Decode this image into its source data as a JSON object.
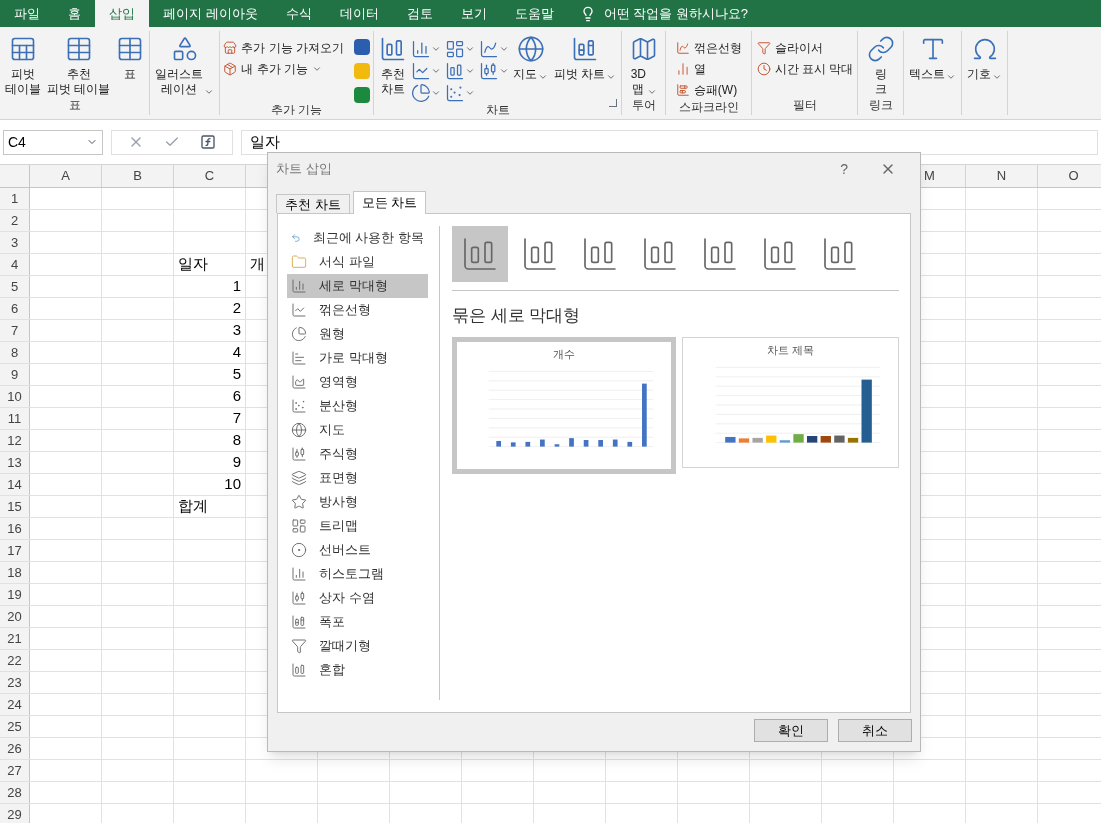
{
  "tabs": [
    {
      "label": "파일",
      "selected": false
    },
    {
      "label": "홈",
      "selected": false
    },
    {
      "label": "삽입",
      "selected": true
    },
    {
      "label": "페이지 레이아웃",
      "selected": false
    },
    {
      "label": "수식",
      "selected": false
    },
    {
      "label": "데이터",
      "selected": false
    },
    {
      "label": "검토",
      "selected": false
    },
    {
      "label": "보기",
      "selected": false
    },
    {
      "label": "도움말",
      "selected": false
    }
  ],
  "tell_me": "어떤 작업을 원하시나요?",
  "ribbon_groups": [
    {
      "label": "표",
      "items": [
        {
          "kind": "large",
          "text": "피벗\n테이블",
          "dropdown": false
        },
        {
          "kind": "large",
          "text": "추천\n피벗 테이블",
          "dropdown": false
        },
        {
          "kind": "large",
          "text": "표",
          "dropdown": false
        }
      ]
    },
    {
      "items": [
        {
          "kind": "large",
          "text": "일러스트\n레이션",
          "dropdown": true
        }
      ]
    },
    {
      "label": "추가 기능",
      "items": [
        {
          "kind": "smallstack",
          "entries": [
            {
              "text": "추가 기능 가져오기",
              "dropdown": false
            },
            {
              "text": "내 추가 기능",
              "dropdown": true
            }
          ]
        },
        {
          "kind": "apps"
        }
      ]
    },
    {
      "label": "차트",
      "launcher": true,
      "items": [
        {
          "kind": "large",
          "text": "추천\n차트",
          "dropdown": false
        },
        {
          "kind": "gallery"
        },
        {
          "kind": "large",
          "text": "지도",
          "dropdown": true
        },
        {
          "kind": "large",
          "text": "피벗 차트",
          "dropdown": true
        }
      ]
    },
    {
      "label": "투어",
      "items": [
        {
          "kind": "large",
          "text": "3D\n맵",
          "dropdown": true
        }
      ]
    },
    {
      "label": "스파크라인",
      "items": [
        {
          "kind": "smallstack",
          "entries": [
            {
              "text": "꺾은선형",
              "dropdown": false
            },
            {
              "text": "열",
              "dropdown": false
            },
            {
              "text": "승패(W)",
              "dropdown": false
            }
          ]
        }
      ]
    },
    {
      "label": "필터",
      "items": [
        {
          "kind": "smallstack",
          "entries": [
            {
              "text": "슬라이서",
              "dropdown": false
            },
            {
              "text": "시간 표시 막대",
              "dropdown": false
            }
          ]
        }
      ]
    },
    {
      "label": "링크",
      "items": [
        {
          "kind": "large",
          "text": "링\n크",
          "dropdown": false
        }
      ]
    },
    {
      "items": [
        {
          "kind": "large",
          "text": "텍스트",
          "dropdown": true
        }
      ]
    },
    {
      "items": [
        {
          "kind": "large",
          "text": "기호",
          "dropdown": true
        }
      ]
    }
  ],
  "formula_bar": {
    "name_box": "C4",
    "value": "일자"
  },
  "sheet": {
    "columns_left": [
      "A",
      "B",
      "C"
    ],
    "columns_right": [
      "M",
      "N",
      "O"
    ],
    "rows": [
      {
        "header": "1"
      },
      {
        "header": "2"
      },
      {
        "header": "3"
      },
      {
        "header": "4",
        "cells": [
          {
            "text": "일자",
            "kind": "text"
          },
          {
            "text": "개"
          }
        ]
      },
      {
        "header": "5",
        "cells": [
          {
            "text": "1",
            "kind": "number"
          }
        ]
      },
      {
        "header": "6",
        "cells": [
          {
            "text": "2",
            "kind": "number"
          }
        ]
      },
      {
        "header": "7",
        "cells": [
          {
            "text": "3",
            "kind": "number"
          }
        ]
      },
      {
        "header": "8",
        "cells": [
          {
            "text": "4",
            "kind": "number"
          }
        ]
      },
      {
        "header": "9",
        "cells": [
          {
            "text": "5",
            "kind": "number"
          }
        ]
      },
      {
        "header": "10",
        "cells": [
          {
            "text": "6",
            "kind": "number"
          }
        ]
      },
      {
        "header": "11",
        "cells": [
          {
            "text": "7",
            "kind": "number"
          }
        ]
      },
      {
        "header": "12",
        "cells": [
          {
            "text": "8",
            "kind": "number"
          }
        ]
      },
      {
        "header": "13",
        "cells": [
          {
            "text": "9",
            "kind": "number"
          }
        ]
      },
      {
        "header": "14",
        "cells": [
          {
            "text": "10",
            "kind": "number"
          }
        ]
      },
      {
        "header": "15",
        "cells": [
          {
            "text": "합계",
            "kind": "text"
          }
        ]
      },
      {
        "header": "16"
      },
      {
        "header": "17"
      },
      {
        "header": "18"
      },
      {
        "header": "19"
      },
      {
        "header": "20"
      },
      {
        "header": "21"
      },
      {
        "header": "22"
      },
      {
        "header": "23"
      },
      {
        "header": "24"
      },
      {
        "header": "25"
      },
      {
        "header": "26"
      },
      {
        "header": "27"
      },
      {
        "header": "28"
      },
      {
        "header": "29"
      }
    ]
  },
  "dialog": {
    "title": "차트 삽입",
    "help": "?",
    "tabs": [
      {
        "label": "추천 차트",
        "selected": false
      },
      {
        "label": "모든 차트",
        "selected": true
      }
    ],
    "chart_types": [
      {
        "label": "최근에 사용한 항목",
        "selected": false
      },
      {
        "label": "서식 파일",
        "selected": false
      },
      {
        "label": "세로 막대형",
        "selected": true
      },
      {
        "label": "꺾은선형",
        "selected": false
      },
      {
        "label": "원형",
        "selected": false
      },
      {
        "label": "가로 막대형",
        "selected": false
      },
      {
        "label": "영역형",
        "selected": false
      },
      {
        "label": "분산형",
        "selected": false
      },
      {
        "label": "지도",
        "selected": false
      },
      {
        "label": "주식형",
        "selected": false
      },
      {
        "label": "표면형",
        "selected": false
      },
      {
        "label": "방사형",
        "selected": false
      },
      {
        "label": "트리맵",
        "selected": false
      },
      {
        "label": "선버스트",
        "selected": false
      },
      {
        "label": "히스토그램",
        "selected": false
      },
      {
        "label": "상자 수염",
        "selected": false
      },
      {
        "label": "폭포",
        "selected": false
      },
      {
        "label": "깔때기형",
        "selected": false
      },
      {
        "label": "혼합",
        "selected": false
      }
    ],
    "subtypes": [
      {
        "selected": true
      },
      {
        "selected": false
      },
      {
        "selected": false
      },
      {
        "selected": false
      },
      {
        "selected": false
      },
      {
        "selected": false
      },
      {
        "selected": false
      }
    ],
    "subtype_title": "묶은 세로 막대형",
    "previews": [
      {
        "title": "개수",
        "selected": true
      },
      {
        "title": "차트 제목",
        "selected": false
      }
    ],
    "buttons": [
      "확인",
      "취소"
    ]
  }
}
